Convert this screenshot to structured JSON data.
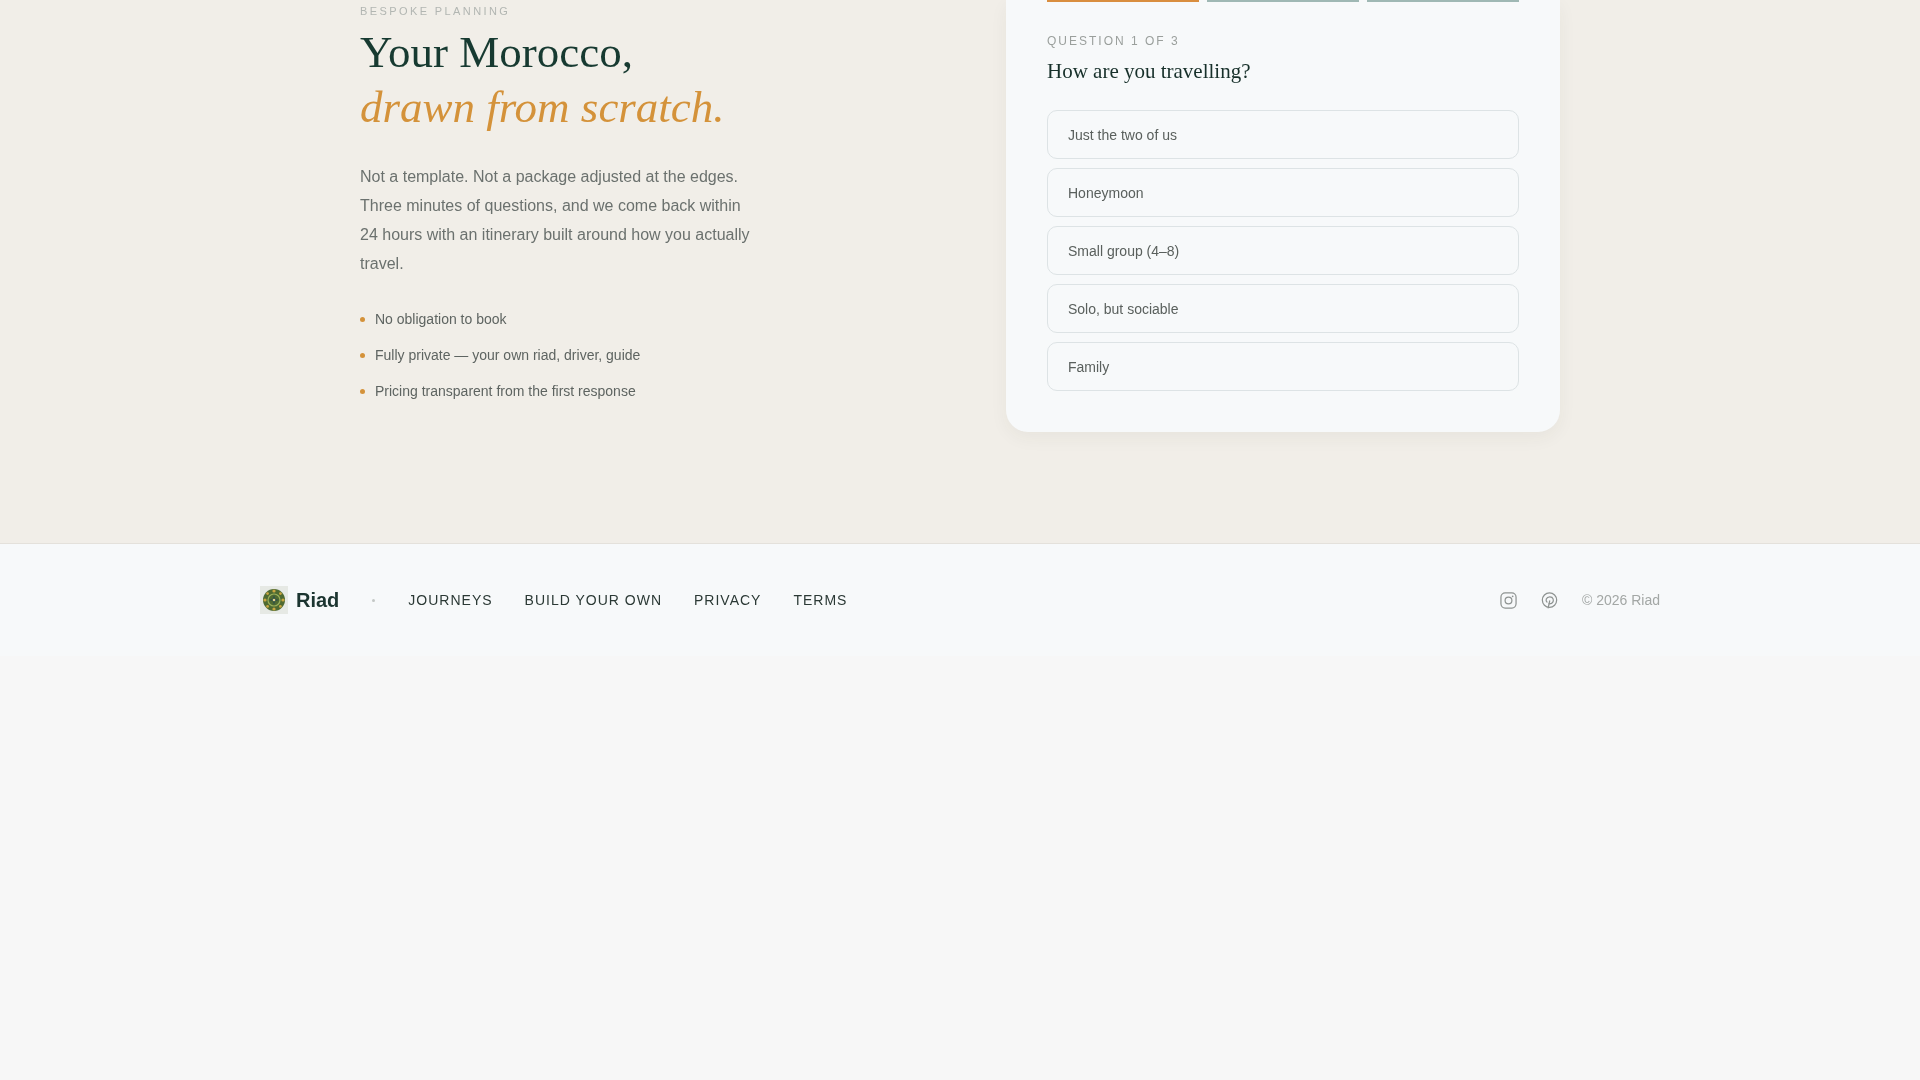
{
  "hero": {
    "eyebrow": "BESPOKE PLANNING",
    "title": "Your Morocco,",
    "title_accent": "drawn from scratch.",
    "lead": "Not a template. Not a package adjusted at the edges. Three minutes of questions, and we come back within 24 hours with an itinerary built around how you actually travel.",
    "points": [
      "No obligation to book",
      "Fully private — your own riad, driver, guide",
      "Pricing transparent from the first response"
    ]
  },
  "quiz": {
    "steps": [
      {
        "active": true
      },
      {
        "active": false
      },
      {
        "active": false
      }
    ],
    "counter": "QUESTION 1 OF 3",
    "question": "How are you travelling?",
    "options": [
      {
        "label": "Just the two of us",
        "selected": false
      },
      {
        "label": "Honeymoon",
        "selected": false
      },
      {
        "label": "Small group (4–8)",
        "selected": false
      },
      {
        "label": "Solo, but sociable",
        "selected": false
      },
      {
        "label": "Family",
        "selected": false
      }
    ]
  },
  "footer": {
    "brand": "Riad",
    "links": [
      "JOURNEYS",
      "BUILD YOUR OWN",
      "PRIVACY",
      "TERMS"
    ],
    "social": [
      {
        "kind": "instagram"
      },
      {
        "kind": "pinterest"
      }
    ],
    "copyright": "© 2026 Riad"
  }
}
